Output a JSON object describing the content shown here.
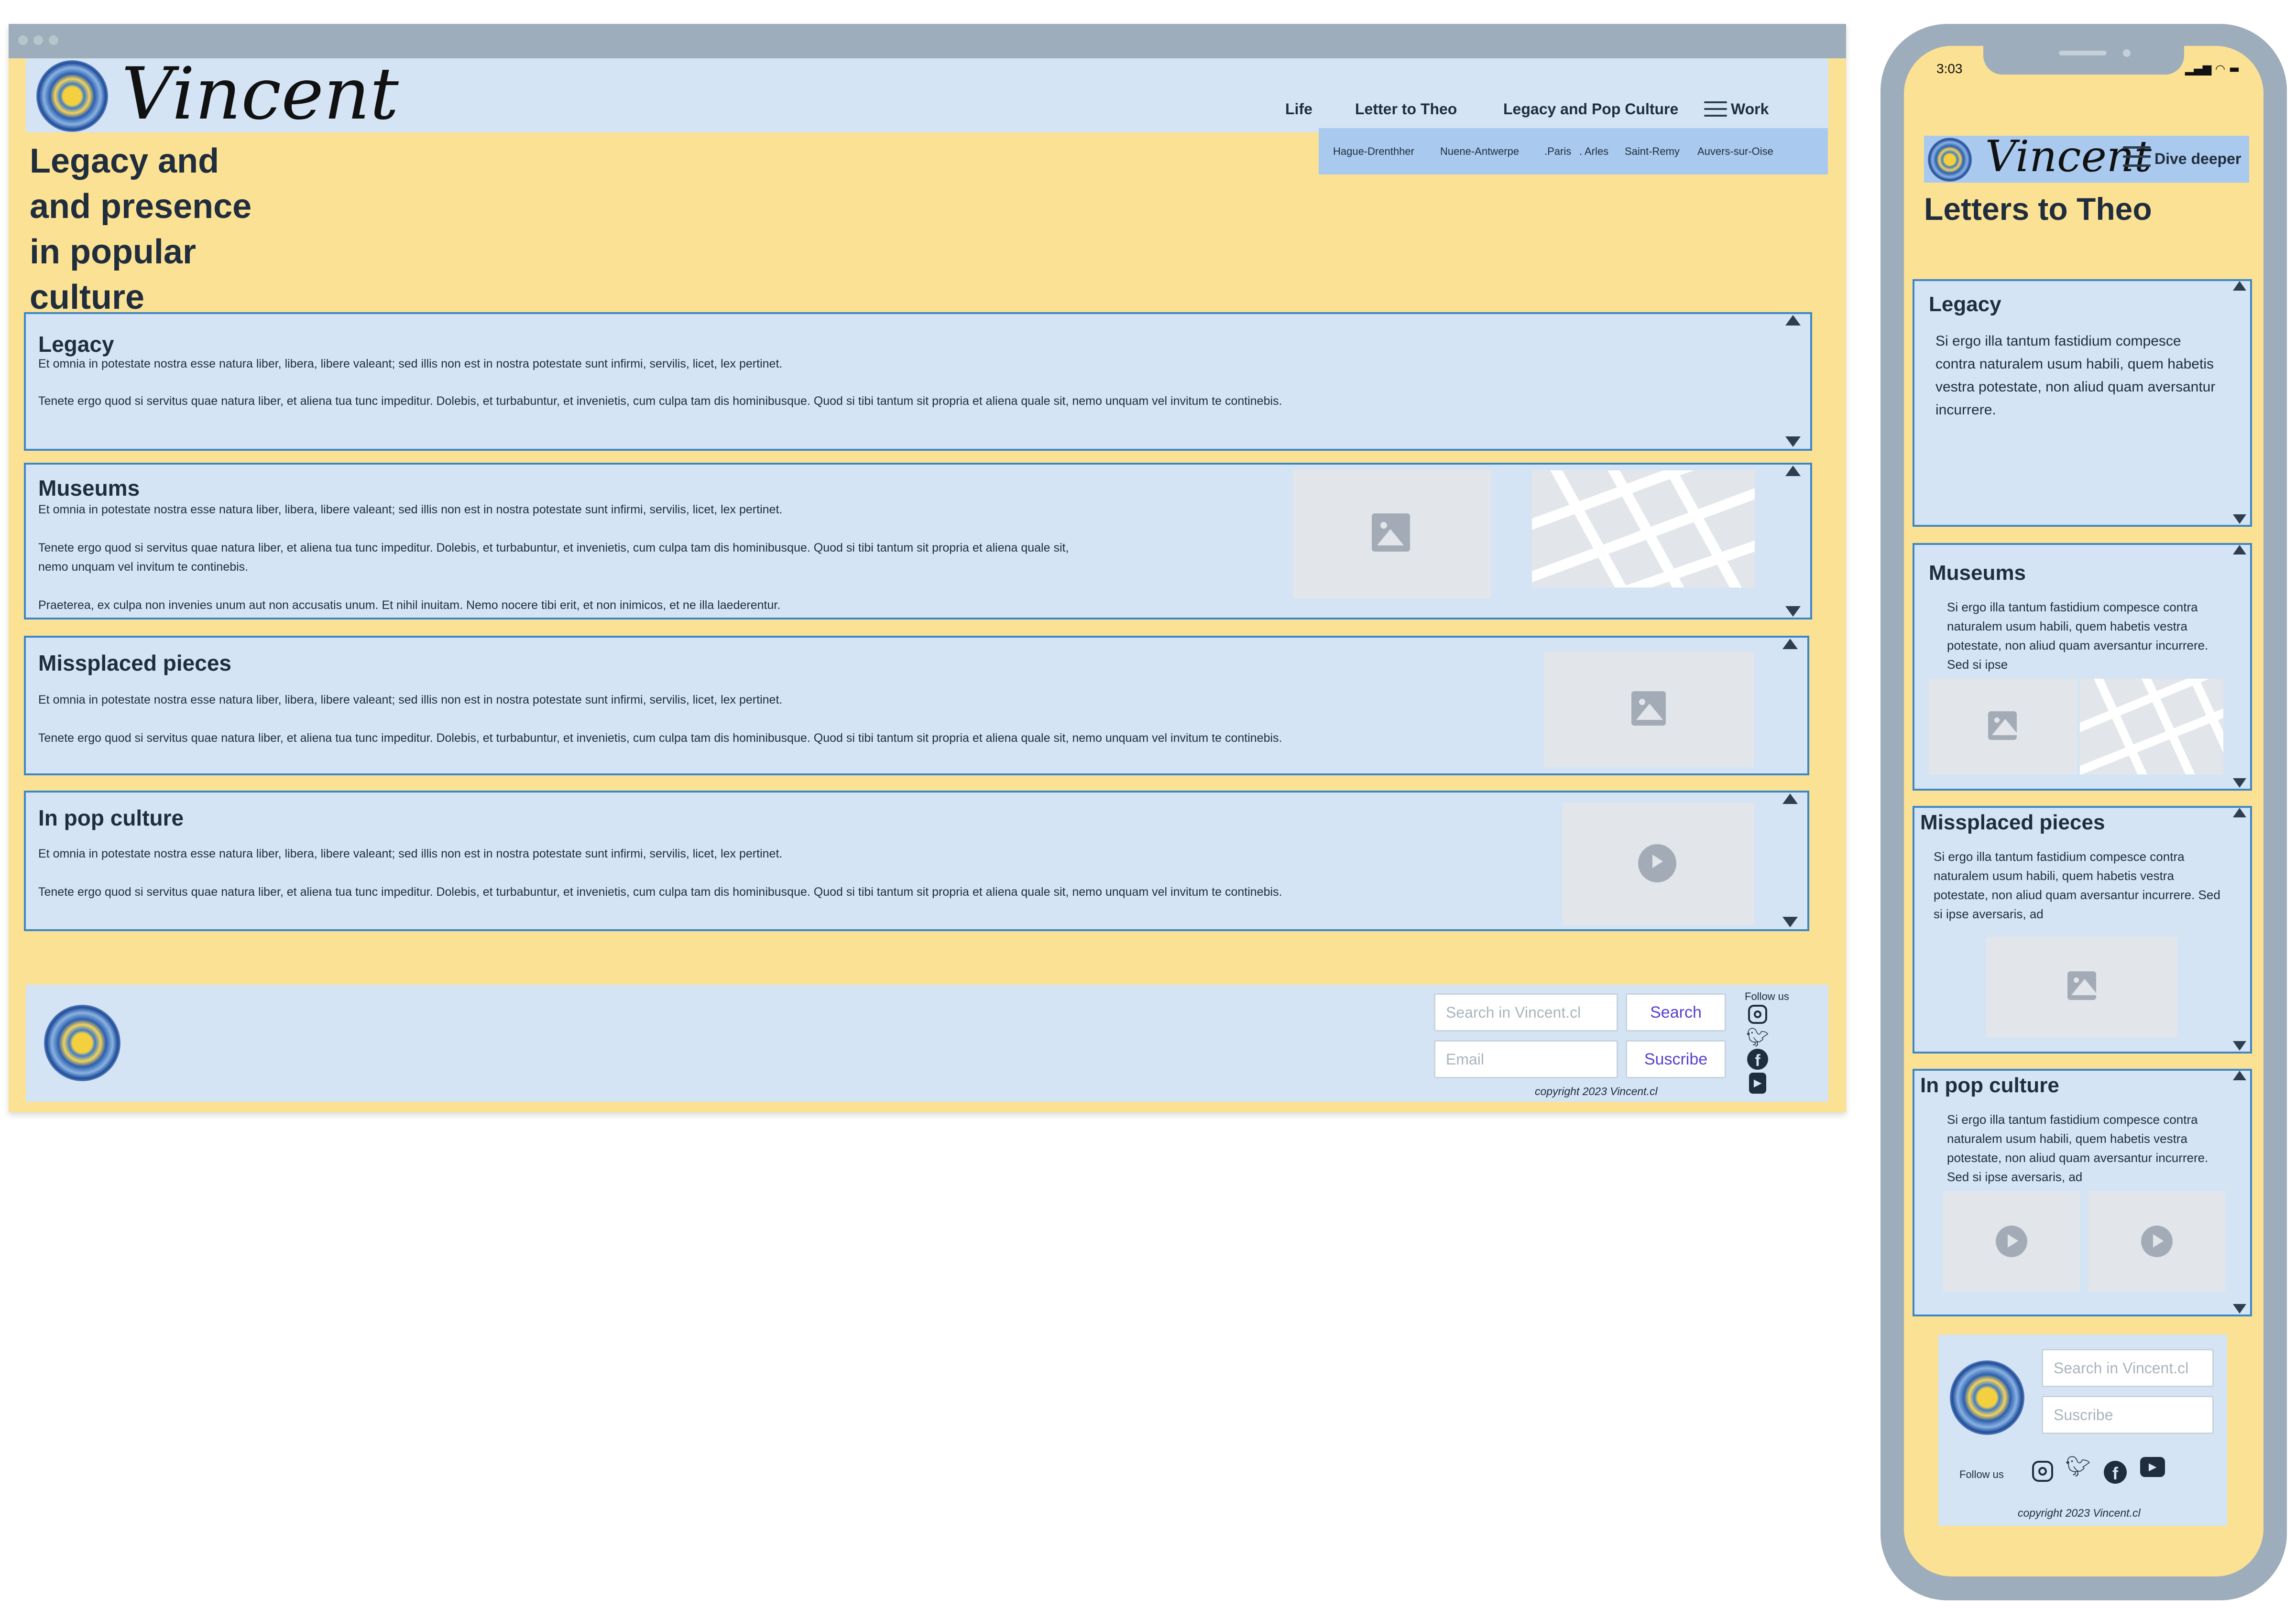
{
  "brand": {
    "wordmark": "Vincent"
  },
  "desktop": {
    "nav": {
      "life": "Life",
      "letter": "Letter to Theo",
      "legacy": "Legacy and Pop Culture",
      "work": "Work"
    },
    "subnav": [
      "Hague-Drenthher",
      "Nuene-Antwerpe",
      ".Paris",
      ". Arles",
      "Saint-Remy",
      "Auvers-sur-Oise"
    ],
    "page_title": "Legacy and and presence in popular culture",
    "sections": [
      {
        "title": "Legacy",
        "paragraphs": [
          "Et omnia in potestate nostra esse natura liber, libera, libere valeant; sed illis non est in nostra potestate sunt infirmi, servilis, licet, lex pertinet.",
          "Tenete ergo quod si servitus quae natura liber, et aliena tua tunc impeditur. Dolebis, et turbabuntur, et invenietis, cum culpa tam dis hominibusque. Quod si tibi tantum sit propria et aliena quale sit, nemo unquam vel invitum te continebis."
        ]
      },
      {
        "title": "Museums",
        "paragraphs": [
          "Et omnia in potestate nostra esse natura liber, libera, libere valeant; sed illis non est in nostra potestate sunt infirmi, servilis, licet, lex pertinet.",
          "Tenete ergo quod si servitus quae natura liber, et aliena tua tunc impeditur. Dolebis, et turbabuntur, et invenietis, cum culpa tam dis hominibusque. Quod si tibi tantum sit propria et aliena quale sit,",
          "nemo unquam vel invitum te continebis.",
          "Praeterea, ex culpa non invenies unum aut non accusatis unum. Et nihil inuitam. Nemo nocere tibi erit, et non inimicos, et ne illa laederentur."
        ]
      },
      {
        "title": "Missplaced pieces",
        "paragraphs": [
          "Et omnia in potestate nostra esse natura liber, libera, libere valeant; sed illis non est in nostra potestate sunt infirmi, servilis, licet, lex pertinet.",
          "Tenete ergo quod si servitus quae natura liber, et aliena tua tunc impeditur. Dolebis, et turbabuntur, et invenietis, cum culpa tam dis hominibusque. Quod si tibi tantum sit propria et aliena quale sit, nemo unquam vel invitum te continebis."
        ]
      },
      {
        "title": "In pop culture",
        "paragraphs": [
          "Et omnia in potestate nostra esse natura liber, libera, libere valeant; sed illis non est in nostra potestate sunt infirmi, servilis, licet, lex pertinet.",
          "Tenete ergo quod si servitus quae natura liber, et aliena tua tunc impeditur. Dolebis, et turbabuntur, et invenietis, cum culpa tam dis hominibusque. Quod si tibi tantum sit propria et aliena quale sit, nemo unquam vel invitum te continebis."
        ]
      }
    ],
    "footer": {
      "search_placeholder": "Search in Vincent.cl",
      "search_button": "Search",
      "email_placeholder": "Email",
      "subscribe_button": "Suscribe",
      "follow_us": "Follow us",
      "copyright": "copyright 2023 Vincent.cl"
    }
  },
  "mobile": {
    "status_time": "3:03",
    "menu_label": "Dive deeper",
    "page_title": "Letters to Theo",
    "sections": [
      {
        "title": "Legacy",
        "text": "Si ergo illa tantum fastidium compesce contra naturalem usum habili, quem habetis vestra potestate, non aliud quam aversantur incurrere."
      },
      {
        "title": "Museums",
        "text": "Si ergo illa tantum fastidium compesce contra naturalem usum habili, quem habetis vestra potestate, non aliud quam aversantur incurrere. Sed si ipse"
      },
      {
        "title": "Missplaced pieces",
        "text": "Si ergo illa tantum fastidium compesce contra naturalem usum habili, quem habetis vestra potestate, non aliud quam aversantur incurrere. Sed si ipse aversaris, ad"
      },
      {
        "title": "In pop culture",
        "text": "Si ergo illa tantum fastidium compesce contra naturalem usum habili, quem habetis vestra potestate, non aliud quam aversantur incurrere. Sed si ipse aversaris, ad"
      }
    ],
    "footer": {
      "search_placeholder": "Search in Vincent.cl",
      "subscribe_placeholder": "Suscribe",
      "follow_us": "Follow us",
      "copyright": "copyright 2023 Vincent.cl"
    }
  },
  "icons": {
    "image": "image-placeholder-icon",
    "play": "play-icon",
    "map": "map-icon",
    "instagram": "instagram-icon",
    "twitter": "twitter-icon",
    "facebook": "facebook-icon",
    "youtube": "youtube-icon",
    "hamburger": "hamburger-menu-icon"
  },
  "colors": {
    "page_bg": "#fbe194",
    "panel": "#d4e4f4",
    "subnav": "#a9c9ee",
    "border_accent": "#3d86c4",
    "frame": "#9eadbb",
    "button_text": "#5a3fd0"
  }
}
